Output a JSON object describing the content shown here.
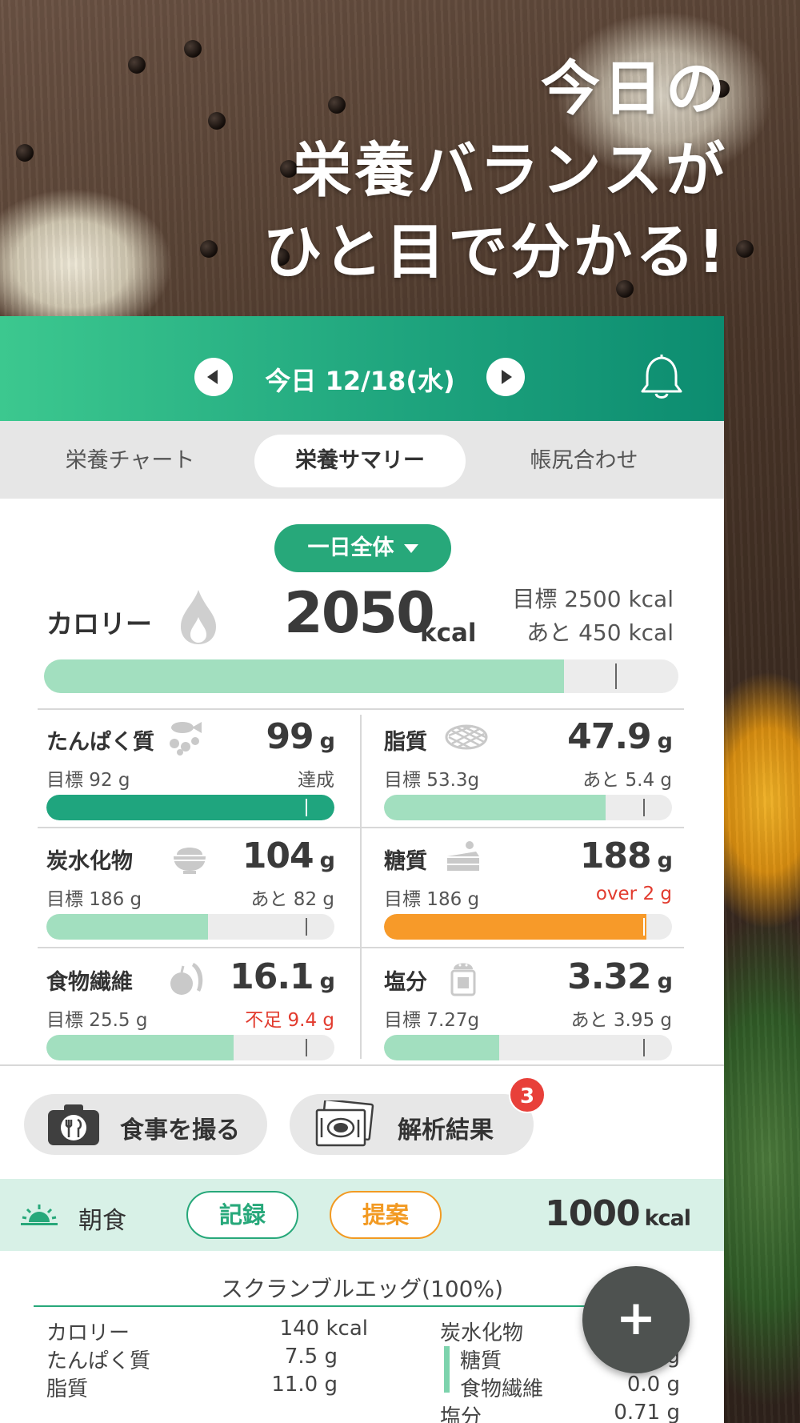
{
  "headline": {
    "line1": "今日の",
    "line2": "栄養バランスが",
    "line3": "ひと目で分かる!"
  },
  "header": {
    "date": "今日 12/18(水)",
    "prev_icon": "chevron-left-icon",
    "next_icon": "chevron-right-icon",
    "bell_icon": "bell-icon"
  },
  "tabs": [
    {
      "label": "栄養チャート",
      "active": false
    },
    {
      "label": "栄養サマリー",
      "active": true
    },
    {
      "label": "帳尻合わせ",
      "active": false
    }
  ],
  "scope_selector": "一日全体",
  "calorie": {
    "label": "カロリー",
    "value": "2050",
    "unit": "kcal",
    "goal": "目標 2500 kcal",
    "remaining": "あと 450 kcal",
    "progress": 0.82,
    "target_mark": 0.9
  },
  "nutrients": [
    {
      "name": "たんぱく質",
      "icon": "fish-beans-icon",
      "value": "99",
      "unit": "g",
      "goal": "目標 92 g",
      "remaining": "達成",
      "status": "achieved",
      "progress": 1.0,
      "target_mark": 0.9,
      "color": "#1fa57e"
    },
    {
      "name": "脂質",
      "icon": "meat-icon",
      "value": "47.9",
      "unit": "g",
      "goal": "目標 53.3g",
      "remaining": "あと 5.4 g",
      "status": "ok",
      "progress": 0.77,
      "target_mark": 0.9,
      "color": "#a2dfbf"
    },
    {
      "name": "炭水化物",
      "icon": "rice-bowl-icon",
      "value": "104",
      "unit": "g",
      "goal": "目標 186 g",
      "remaining": "あと 82 g",
      "status": "ok",
      "progress": 0.56,
      "target_mark": 0.9,
      "color": "#a2dfbf"
    },
    {
      "name": "糖質",
      "icon": "cake-icon",
      "value": "188",
      "unit": "g",
      "goal": "目標 186 g",
      "remaining": "over 2 g",
      "status": "over",
      "progress": 0.91,
      "target_mark": 0.9,
      "color": "#f79a29"
    },
    {
      "name": "食物繊維",
      "icon": "fruit-vegetable-icon",
      "value": "16.1",
      "unit": "g",
      "goal": "目標 25.5 g",
      "remaining": "不足 9.4 g",
      "status": "short",
      "progress": 0.65,
      "target_mark": 0.9,
      "color": "#a2dfbf"
    },
    {
      "name": "塩分",
      "icon": "salt-shaker-icon",
      "value": "3.32",
      "unit": "g",
      "goal": "目標 7.27g",
      "remaining": "あと 3.95 g",
      "status": "ok",
      "progress": 0.4,
      "target_mark": 0.9,
      "color": "#a2dfbf"
    }
  ],
  "actions": {
    "photo_label": "食事を撮る",
    "photo_icon": "camera-icon",
    "analysis_label": "解析結果",
    "analysis_icon": "photos-icon",
    "badge": "3"
  },
  "meal": {
    "icon": "sunrise-icon",
    "name": "朝食",
    "record_label": "記録",
    "suggest_label": "提案",
    "kcal": "1000",
    "unit": "kcal"
  },
  "food": {
    "title": "スクランブルエッグ(100%)",
    "left": [
      {
        "label": "カロリー",
        "value": "140 kcal"
      },
      {
        "label": "たんぱく質",
        "value": "7.5 g"
      },
      {
        "label": "脂質",
        "value": "11.0 g"
      }
    ],
    "right": [
      {
        "label": "炭水化物",
        "value": ""
      },
      {
        "label": "糖質",
        "value": "g"
      },
      {
        "label": "食物繊維",
        "value": "0.0 g"
      },
      {
        "label": "塩分",
        "value": "0.71 g"
      }
    ]
  },
  "fab_label": "+",
  "colors": {
    "accent": "#27a87a",
    "header_gradient_start": "#3cc88f",
    "header_gradient_end": "#0c8c70",
    "over": "#f79a29",
    "warning_text": "#e23b2e",
    "meal_band": "#d8f1e7"
  }
}
